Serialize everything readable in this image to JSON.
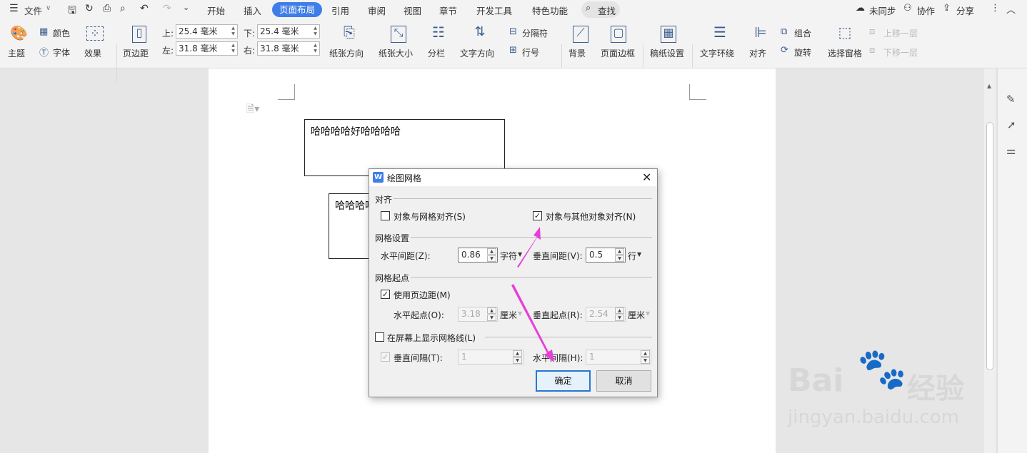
{
  "menubar": {
    "file": "文件",
    "tabs": [
      "开始",
      "插入",
      "页面布局",
      "引用",
      "审阅",
      "视图",
      "章节",
      "开发工具",
      "特色功能"
    ],
    "active_tab": "页面布局",
    "search": "查找",
    "sync": "未同步",
    "collab": "协作",
    "share": "分享"
  },
  "ribbon": {
    "theme": "主题",
    "color": "颜色",
    "font": "字体",
    "effect": "效果",
    "margin": "页边距",
    "top_label": "上:",
    "top_value": "25.4 毫米",
    "bottom_label": "下:",
    "bottom_value": "25.4 毫米",
    "left_label": "左:",
    "left_value": "31.8 毫米",
    "right_label": "右:",
    "right_value": "31.8 毫米",
    "orientation": "纸张方向",
    "size": "纸张大小",
    "columns": "分栏",
    "text_direction": "文字方向",
    "separator": "分隔符",
    "line_number": "行号",
    "background": "背景",
    "page_border": "页面边框",
    "manuscript": "稿纸设置",
    "wrap": "文字环绕",
    "align": "对齐",
    "group": "组合",
    "rotate": "旋转",
    "selection_pane": "选择窗格",
    "bring_forward": "上移一层",
    "send_backward": "下移一层"
  },
  "document": {
    "textbox1": "哈哈哈哈好哈哈哈哈",
    "textbox2": "哈哈哈哈"
  },
  "dialog": {
    "title": "绘图网格",
    "align_group": "对齐",
    "snap_to_grid": "对象与网格对齐(S)",
    "snap_to_grid_checked": false,
    "snap_to_objects": "对象与其他对象对齐(N)",
    "snap_to_objects_checked": true,
    "grid_settings_group": "网格设置",
    "h_spacing_label": "水平间距(Z):",
    "h_spacing_value": "0.86",
    "h_spacing_unit": "字符",
    "v_spacing_label": "垂直间距(V):",
    "v_spacing_value": "0.5",
    "v_spacing_unit": "行",
    "origin_group": "网格起点",
    "use_margins": "使用页边距(M)",
    "use_margins_checked": true,
    "h_origin_label": "水平起点(O):",
    "h_origin_value": "3.18",
    "h_origin_unit": "厘米",
    "v_origin_label": "垂直起点(R):",
    "v_origin_value": "2.54",
    "v_origin_unit": "厘米",
    "show_grid": "在屏幕上显示网格线(L)",
    "show_grid_checked": false,
    "v_every_label": "垂直间隔(T):",
    "v_every_value": "1",
    "h_every_label": "水平间隔(H):",
    "h_every_value": "1",
    "ok": "确定",
    "cancel": "取消"
  },
  "watermark": {
    "brand": "Bai",
    "brand2": "经验",
    "url": "jingyan.baidu.com"
  },
  "colors": {
    "accent": "#3f7ee8",
    "arrow": "#e83fd8"
  }
}
